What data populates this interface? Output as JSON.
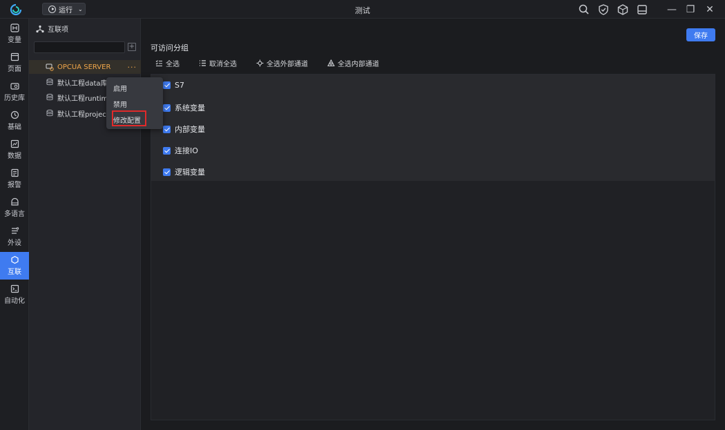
{
  "titlebar": {
    "run_label": "运行",
    "window_title": "测试"
  },
  "nav": {
    "items": [
      {
        "label": "变量",
        "icon": "variable-icon"
      },
      {
        "label": "页面",
        "icon": "page-icon"
      },
      {
        "label": "历史库",
        "icon": "history-db-icon"
      },
      {
        "label": "基础",
        "icon": "basic-icon"
      },
      {
        "label": "数据",
        "icon": "data-icon"
      },
      {
        "label": "报警",
        "icon": "alarm-icon"
      },
      {
        "label": "多语言",
        "icon": "language-icon"
      },
      {
        "label": "外设",
        "icon": "peripheral-icon"
      },
      {
        "label": "互联",
        "icon": "interconnect-icon"
      },
      {
        "label": "自动化",
        "icon": "automation-icon"
      }
    ],
    "active_index": 8
  },
  "tree": {
    "header": "互联项",
    "search_placeholder": "",
    "items": [
      {
        "label": "OPCUA SERVER",
        "selected": true
      },
      {
        "label": "默认工程data库"
      },
      {
        "label": "默认工程runtim"
      },
      {
        "label": "默认工程project"
      }
    ],
    "more_label": "···"
  },
  "context_menu": {
    "items": [
      "启用",
      "禁用",
      "修改配置"
    ],
    "highlighted_index": 2,
    "highlight_color": "#e02a2a"
  },
  "main": {
    "save_label": "保存",
    "section_title": "可访问分组",
    "toolbar": {
      "select_all": "全选",
      "deselect_all": "取消全选",
      "select_external": "全选外部通道",
      "select_internal": "全选内部通道"
    },
    "groups": [
      {
        "label": "S7",
        "checked": true
      },
      {
        "label": "系统变量",
        "checked": true
      },
      {
        "label": "内部变量",
        "checked": true
      },
      {
        "label": "连接IO",
        "checked": true
      },
      {
        "label": "逻辑变量",
        "checked": true
      }
    ]
  },
  "colors": {
    "accent": "#3f7bf0",
    "selected_text": "#f0a64a"
  }
}
